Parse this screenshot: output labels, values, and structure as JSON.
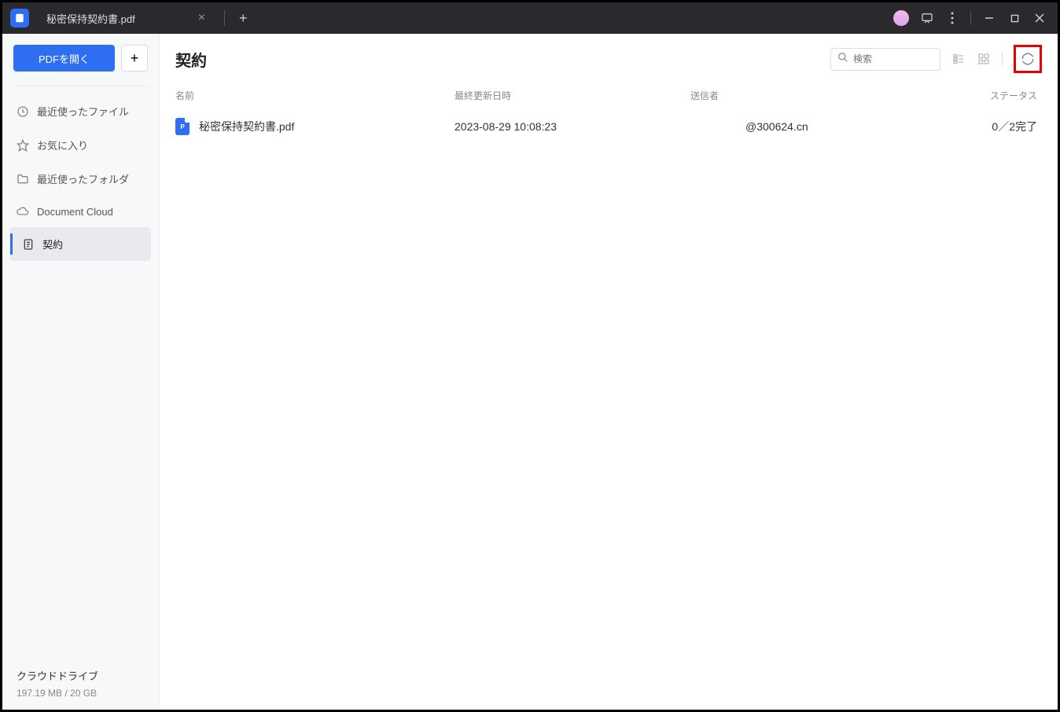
{
  "titlebar": {
    "tab_title": "秘密保持契約書.pdf"
  },
  "sidebar": {
    "open_button": "PDFを開く",
    "items": [
      {
        "label": "最近使ったファイル",
        "icon": "clock"
      },
      {
        "label": "お気に入り",
        "icon": "star"
      },
      {
        "label": "最近使ったフォルダ",
        "icon": "folder"
      },
      {
        "label": "Document Cloud",
        "icon": "cloud"
      },
      {
        "label": "契約",
        "icon": "document"
      }
    ],
    "cloud_title": "クラウドドライブ",
    "storage": "197.19 MB / 20 GB"
  },
  "main": {
    "title": "契約",
    "search_placeholder": "検索",
    "columns": {
      "name": "名前",
      "date": "最終更新日時",
      "sender": "送信者",
      "status": "ステータス"
    },
    "rows": [
      {
        "name": "秘密保持契約書.pdf",
        "date": "2023-08-29 10:08:23",
        "sender": "@300624.cn",
        "status": "0／2完了"
      }
    ]
  }
}
